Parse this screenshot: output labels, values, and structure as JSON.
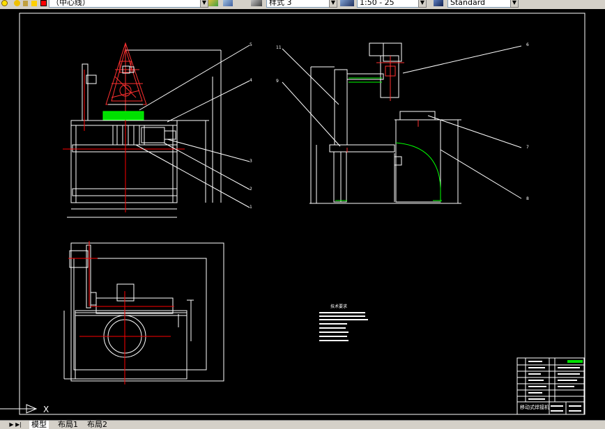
{
  "toolbar": {
    "layer_value": "（中心线）",
    "style_value": "样式 3",
    "scale_value": "1:50 - 25",
    "textstyle_value": "Standard"
  },
  "tabs": [
    {
      "label": "模型"
    },
    {
      "label": "布局1"
    },
    {
      "label": "布局2"
    }
  ],
  "notes_title": "技术要求",
  "callouts": [
    "5",
    "4",
    "3",
    "2",
    "1",
    "11",
    "9",
    "6",
    "7",
    "8"
  ],
  "ucs": {
    "label": "X"
  },
  "titleblock": {
    "title": "移动式焊接机"
  },
  "colors": {
    "background": "#000000",
    "lines": "#ffffff",
    "highlight": "#ff0000",
    "accent": "#00ff00",
    "machine_red": "#ff3030"
  }
}
